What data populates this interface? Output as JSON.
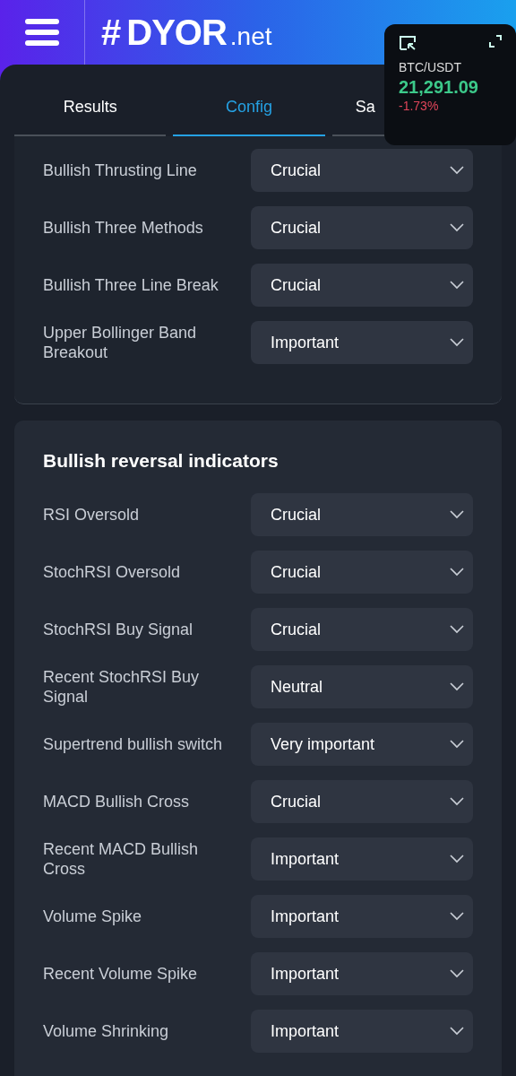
{
  "header": {
    "logo_hash": "#",
    "logo_name": "DYOR",
    "logo_suffix": ".net"
  },
  "tabs": [
    {
      "label": "Results",
      "selected": false
    },
    {
      "label": "Config",
      "selected": true
    },
    {
      "label": "Sa",
      "selected": false
    }
  ],
  "ticker": {
    "pair": "BTC/USDT",
    "price": "21,291.09",
    "change": "-1.73%"
  },
  "sections": [
    {
      "rows": [
        {
          "label": "Bullish Thrusting Line",
          "value": "Crucial"
        },
        {
          "label": "Bullish Three Methods",
          "value": "Crucial"
        },
        {
          "label": "Bullish Three Line Break",
          "value": "Crucial"
        },
        {
          "label": "Upper Bollinger Band Breakout",
          "value": "Important"
        }
      ]
    },
    {
      "title": "Bullish reversal indicators",
      "rows": [
        {
          "label": "RSI Oversold",
          "value": "Crucial"
        },
        {
          "label": "StochRSI Oversold",
          "value": "Crucial"
        },
        {
          "label": "StochRSI Buy Signal",
          "value": "Crucial"
        },
        {
          "label": "Recent StochRSI Buy Signal",
          "value": "Neutral"
        },
        {
          "label": "Supertrend bullish switch",
          "value": "Very important"
        },
        {
          "label": "MACD Bullish Cross",
          "value": "Crucial"
        },
        {
          "label": "Recent MACD Bullish Cross",
          "value": "Important"
        },
        {
          "label": "Volume Spike",
          "value": "Important"
        },
        {
          "label": "Recent Volume Spike",
          "value": "Important"
        },
        {
          "label": "Volume Shrinking",
          "value": "Important"
        }
      ]
    }
  ]
}
